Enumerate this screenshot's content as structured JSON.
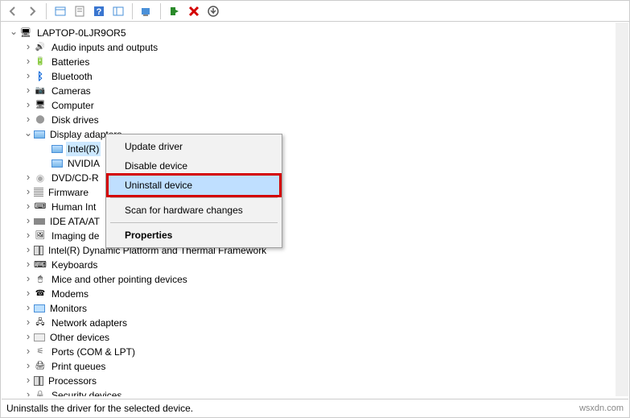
{
  "root_label": "LAPTOP-0LJR9OR5",
  "categories": [
    {
      "label": "Audio inputs and outputs",
      "icon": "audio-icon"
    },
    {
      "label": "Batteries",
      "icon": "bat-icon"
    },
    {
      "label": "Bluetooth",
      "icon": "bt-icon"
    },
    {
      "label": "Cameras",
      "icon": "cam-icon"
    },
    {
      "label": "Computer",
      "icon": "pc-icon"
    },
    {
      "label": "Disk drives",
      "icon": "disk-icon"
    }
  ],
  "display_adapters": {
    "label": "Display adapters",
    "children": [
      {
        "label": "Intel(R)"
      },
      {
        "label": "NVIDIA"
      }
    ]
  },
  "after": [
    {
      "label": "DVD/CD-R",
      "icon": "dvd-icon",
      "truncated": true
    },
    {
      "label": "Firmware",
      "icon": "fw-icon",
      "truncated": true
    },
    {
      "label": "Human Int",
      "icon": "hid-icon",
      "truncated": true
    },
    {
      "label": "IDE ATA/AT",
      "icon": "ata-icon",
      "truncated": true
    },
    {
      "label": "Imaging de",
      "icon": "img-icon",
      "truncated": true
    },
    {
      "label": "Intel(R) Dynamic Platform and Thermal Framework",
      "icon": "chip-icon"
    },
    {
      "label": "Keyboards",
      "icon": "kb-icon"
    },
    {
      "label": "Mice and other pointing devices",
      "icon": "mouse-icon"
    },
    {
      "label": "Modems",
      "icon": "modem-icon"
    },
    {
      "label": "Monitors",
      "icon": "mon-icon"
    },
    {
      "label": "Network adapters",
      "icon": "net-icon"
    },
    {
      "label": "Other devices",
      "icon": "other-icon"
    },
    {
      "label": "Ports (COM & LPT)",
      "icon": "port-icon"
    },
    {
      "label": "Print queues",
      "icon": "print-icon"
    },
    {
      "label": "Processors",
      "icon": "chip-icon"
    },
    {
      "label": "Security devices",
      "icon": "sec-icon"
    }
  ],
  "context_menu": {
    "items": [
      {
        "label": "Update driver"
      },
      {
        "label": "Disable device"
      },
      {
        "label": "Uninstall device",
        "highlight": true
      },
      {
        "sep": true
      },
      {
        "label": "Scan for hardware changes"
      },
      {
        "sep": true
      },
      {
        "label": "Properties",
        "bold": true
      }
    ]
  },
  "status_text": "Uninstalls the driver for the selected device.",
  "watermark": "wsxdn.com"
}
